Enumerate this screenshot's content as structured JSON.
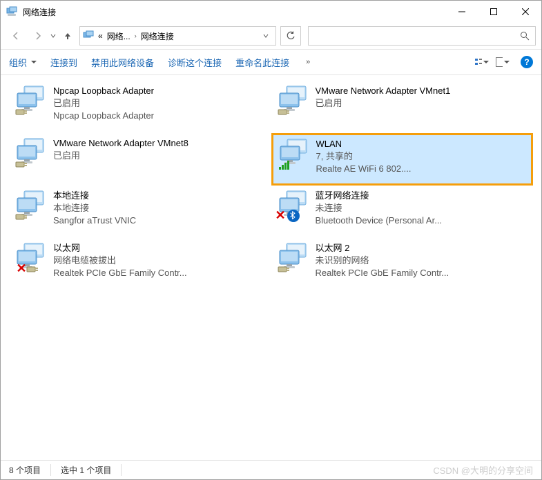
{
  "window": {
    "title": "网络连接"
  },
  "addressbar": {
    "crumb1": "网络...",
    "crumb2": "网络连接"
  },
  "toolbar": {
    "organize": "组织",
    "connect_to": "连接到",
    "disable": "禁用此网络设备",
    "diagnose": "诊断这个连接",
    "rename": "重命名此连接",
    "more": "»"
  },
  "items": [
    {
      "name": "Npcap Loopback Adapter",
      "status": "已启用",
      "detail": "Npcap Loopback Adapter",
      "icon": "net",
      "badge": "plug"
    },
    {
      "name": "VMware Network Adapter VMnet1",
      "status": "已启用",
      "detail": "",
      "icon": "net",
      "badge": "plug"
    },
    {
      "name": "VMware Network Adapter VMnet8",
      "status": "已启用",
      "detail": "",
      "icon": "net",
      "badge": "plug"
    },
    {
      "name": "WLAN",
      "status": "7, 共享的",
      "detail": "Realte               AE WiFi 6 802....",
      "icon": "net",
      "badge": "wifi",
      "selected": true,
      "highlight": true
    },
    {
      "name": "本地连接",
      "status": "本地连接",
      "detail": "Sangfor aTrust VNIC",
      "icon": "net",
      "badge": "plug"
    },
    {
      "name": "蓝牙网络连接",
      "status": "未连接",
      "detail": "Bluetooth Device (Personal Ar...",
      "icon": "net",
      "badge": "bt-x"
    },
    {
      "name": "以太网",
      "status": "网络电缆被拔出",
      "detail": "Realtek PCIe GbE Family Contr...",
      "icon": "net",
      "badge": "x"
    },
    {
      "name": "以太网 2",
      "status": "未识别的网络",
      "detail": "Realtek PCIe GbE Family Contr...",
      "icon": "net",
      "badge": "plug"
    }
  ],
  "statusbar": {
    "count": "8 个项目",
    "selected": "选中 1 个项目"
  },
  "watermark": "CSDN @大明的分享空间"
}
